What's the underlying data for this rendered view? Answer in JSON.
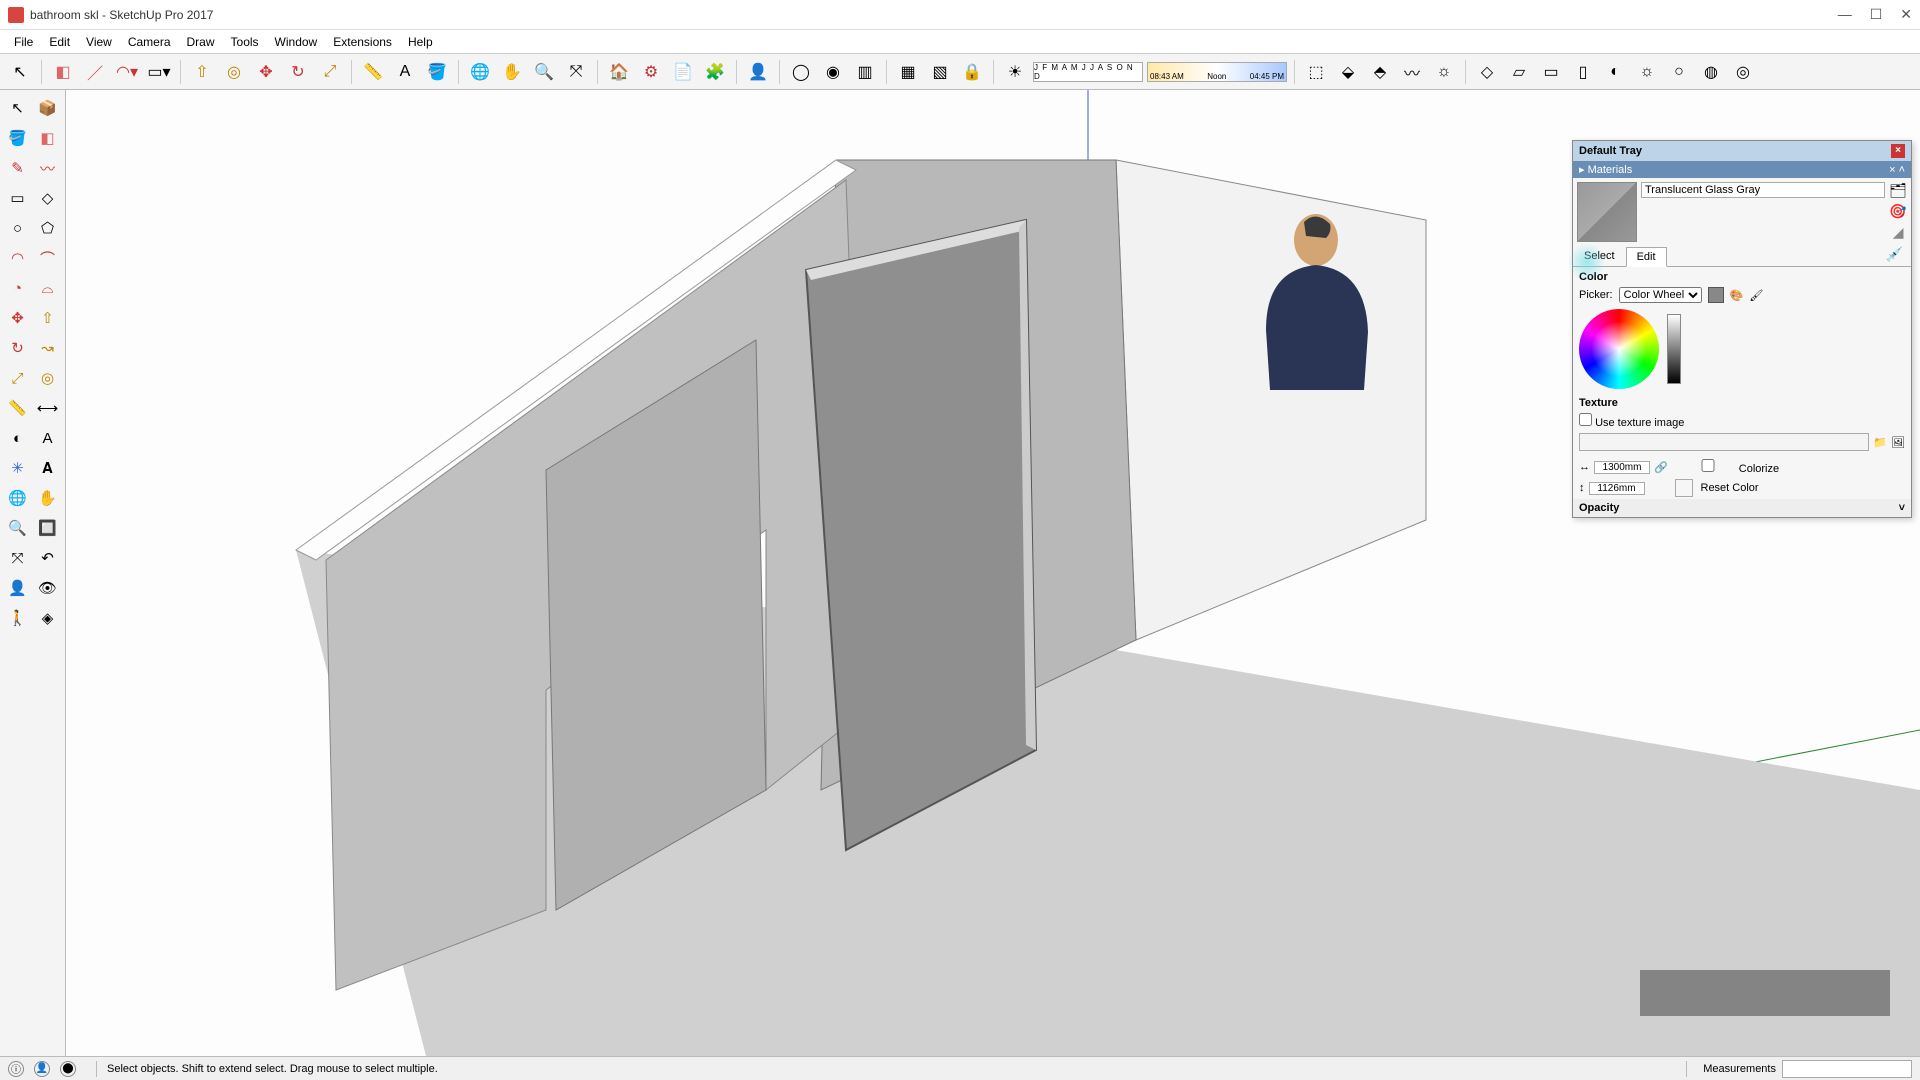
{
  "titlebar": {
    "title": "bathroom skl - SketchUp Pro 2017"
  },
  "menu": [
    "File",
    "Edit",
    "View",
    "Camera",
    "Draw",
    "Tools",
    "Window",
    "Extensions",
    "Help"
  ],
  "time_slider": {
    "left": "08:43 AM",
    "mid": "Noon",
    "right": "04:45 PM"
  },
  "date_slider": "J F M A M J J A S O N D",
  "tray": {
    "title": "Default Tray",
    "panel": "Materials",
    "material_name": "Translucent Glass Gray",
    "tabs": {
      "select": "Select",
      "edit": "Edit"
    },
    "color_label": "Color",
    "picker_label": "Picker:",
    "picker_value": "Color Wheel",
    "texture_label": "Texture",
    "use_texture": "Use texture image",
    "dim_w": "1300mm",
    "dim_h": "1126mm",
    "colorize": "Colorize",
    "reset_color": "Reset Color",
    "opacity_label": "Opacity"
  },
  "status": {
    "hint": "Select objects. Shift to extend select. Drag mouse to select multiple.",
    "measurements_label": "Measurements"
  }
}
